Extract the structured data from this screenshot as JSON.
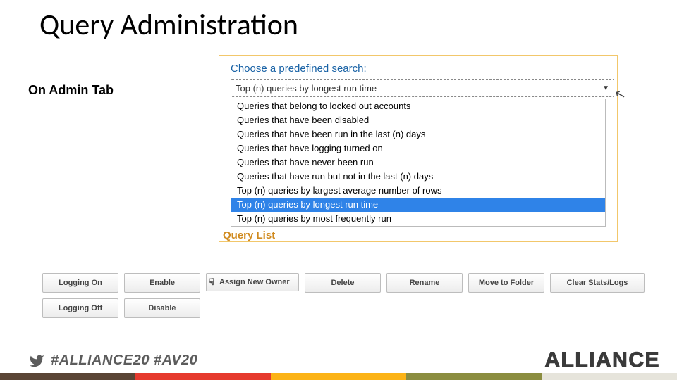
{
  "title": "Query Administration",
  "subtitle": "On Admin Tab",
  "panel": {
    "label": "Choose a predefined search:",
    "selected": "Top (n) queries by longest run time",
    "options": [
      "Queries that belong to locked out accounts",
      "Queries that have been disabled",
      "Queries that have been run in the last (n) days",
      "Queries that have logging turned on",
      "Queries that have never been run",
      "Queries that have run but not in the last (n) days",
      "Top (n) queries by largest average number of rows",
      "Top (n) queries by longest run time",
      "Top (n) queries by most frequently run"
    ],
    "highlighted_index": 7,
    "cut_label": "Query List"
  },
  "buttons": {
    "row1": [
      "Logging On",
      "Enable",
      "Assign New Owner",
      "Delete",
      "Rename",
      "Move to Folder",
      "Clear Stats/Logs"
    ],
    "row2": [
      "Logging Off",
      "Disable"
    ]
  },
  "footer": {
    "hashtags": "#ALLIANCE20 #AV20",
    "brand": "ALLIANCE",
    "stripe_colors": [
      "#5a4535",
      "#e63a2e",
      "#fcb316",
      "#8b8d40",
      "#e6e4db"
    ]
  }
}
